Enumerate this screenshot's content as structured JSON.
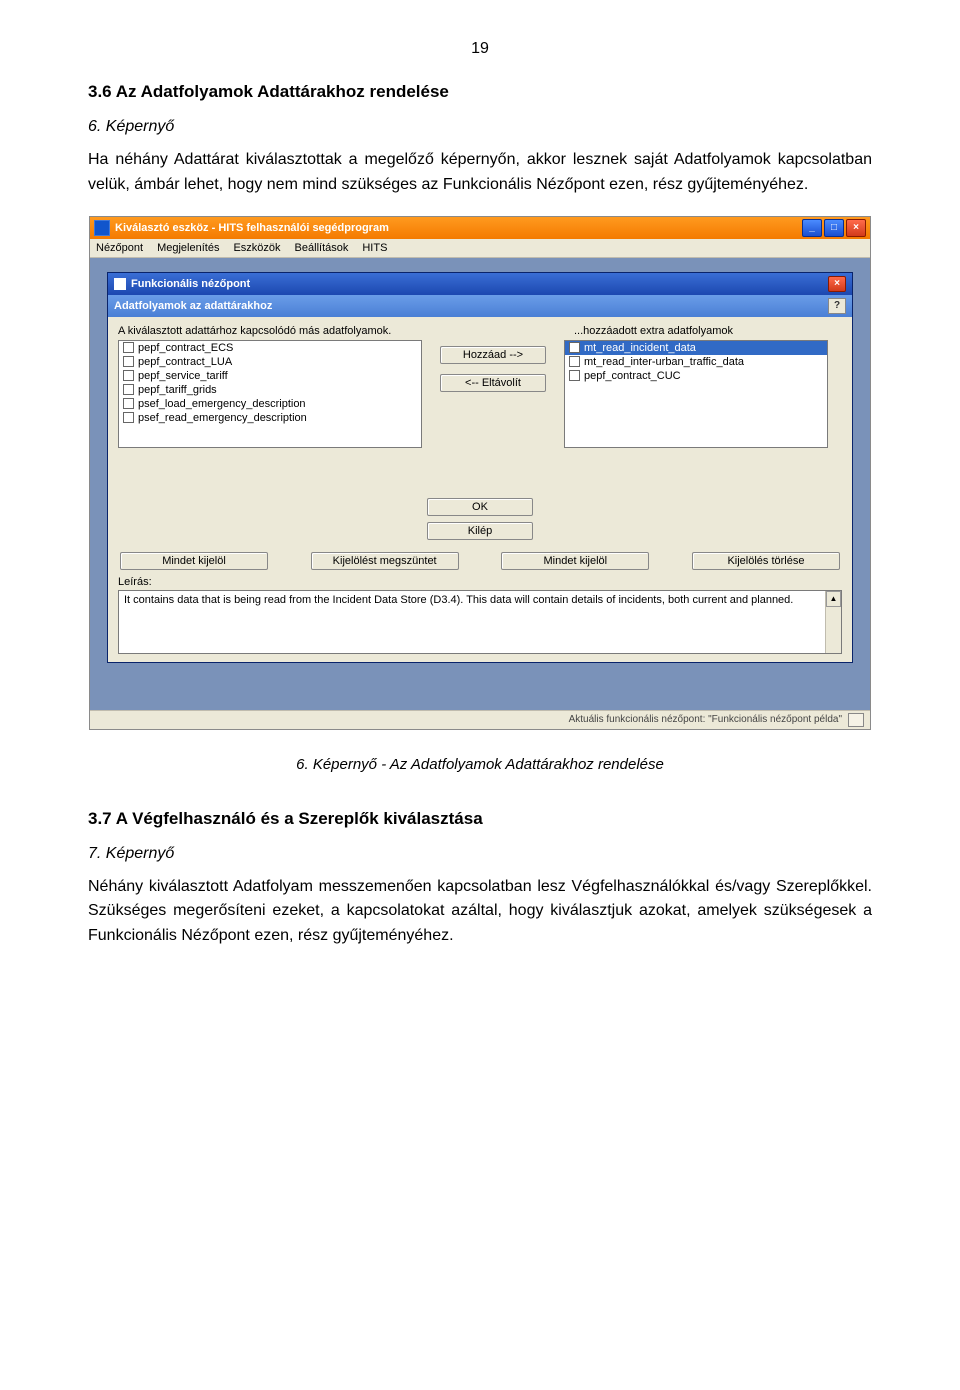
{
  "page_number": "19",
  "section1": {
    "heading": "3.6 Az Adatfolyamok Adattárakhoz rendelése",
    "subhead": "6. Képernyő",
    "paragraph": "Ha néhány Adattárat kiválasztottak a megelőző képernyőn, akkor lesznek saját Adatfolyamok kapcsolatban velük, ámbár lehet, hogy nem mind szükséges az Funkcionális Nézőpont ezen, rész gyűjteményéhez."
  },
  "caption": "6. Képernyő - Az Adatfolyamok Adattárakhoz rendelése",
  "section2": {
    "heading": "3.7 A Végfelhasználó és a Szereplők kiválasztása",
    "subhead": "7. Képernyő",
    "paragraph": "Néhány kiválasztott Adatfolyam messzemenően kapcsolatban lesz Végfelhasználókkal és/vagy Szereplőkkel. Szükséges megerősíteni ezeket, a kapcsolatokat azáltal, hogy kiválasztjuk azokat, amelyek szükségesek a Funkcionális Nézőpont ezen, rész gyűjteményéhez."
  },
  "screenshot": {
    "window_title": "Kiválasztó eszköz - HITS felhasználói segédprogram",
    "menus": [
      "Nézőpont",
      "Megjelenítés",
      "Eszközök",
      "Beállítások",
      "HITS"
    ],
    "dialog_title": "Funkcionális nézőpont",
    "dialog_subtitle": "Adatfolyamok az adattárakhoz",
    "help_char": "?",
    "label_left": "A kiválasztott adattárhoz kapcsolódó más adatfolyamok.",
    "label_right": "...hozzáadott extra adatfolyamok",
    "left_items": [
      "pepf_contract_ECS",
      "pepf_contract_LUA",
      "pepf_service_tariff",
      "pepf_tariff_grids",
      "psef_load_emergency_description",
      "psef_read_emergency_description"
    ],
    "right_items": [
      "mt_read_incident_data",
      "mt_read_inter-urban_traffic_data",
      "pepf_contract_CUC"
    ],
    "btn_add": "Hozzáad  -->",
    "btn_remove": "<--  Eltávolít",
    "btn_ok": "OK",
    "btn_kilep": "Kilép",
    "btn_mindet1": "Mindet kijelöl",
    "btn_megszuntet": "Kijelölést megszüntet",
    "btn_mindet2": "Mindet kijelöl",
    "btn_torles": "Kijelölés törlése",
    "leiras_label": "Leírás:",
    "description_text": "It contains data that is being read from the Incident Data Store (D3.4).  This data will contain details of incidents, both current and planned.",
    "status_text": "Aktuális funkcionális nézőpont: \"Funkcionális nézőpont példa\""
  }
}
